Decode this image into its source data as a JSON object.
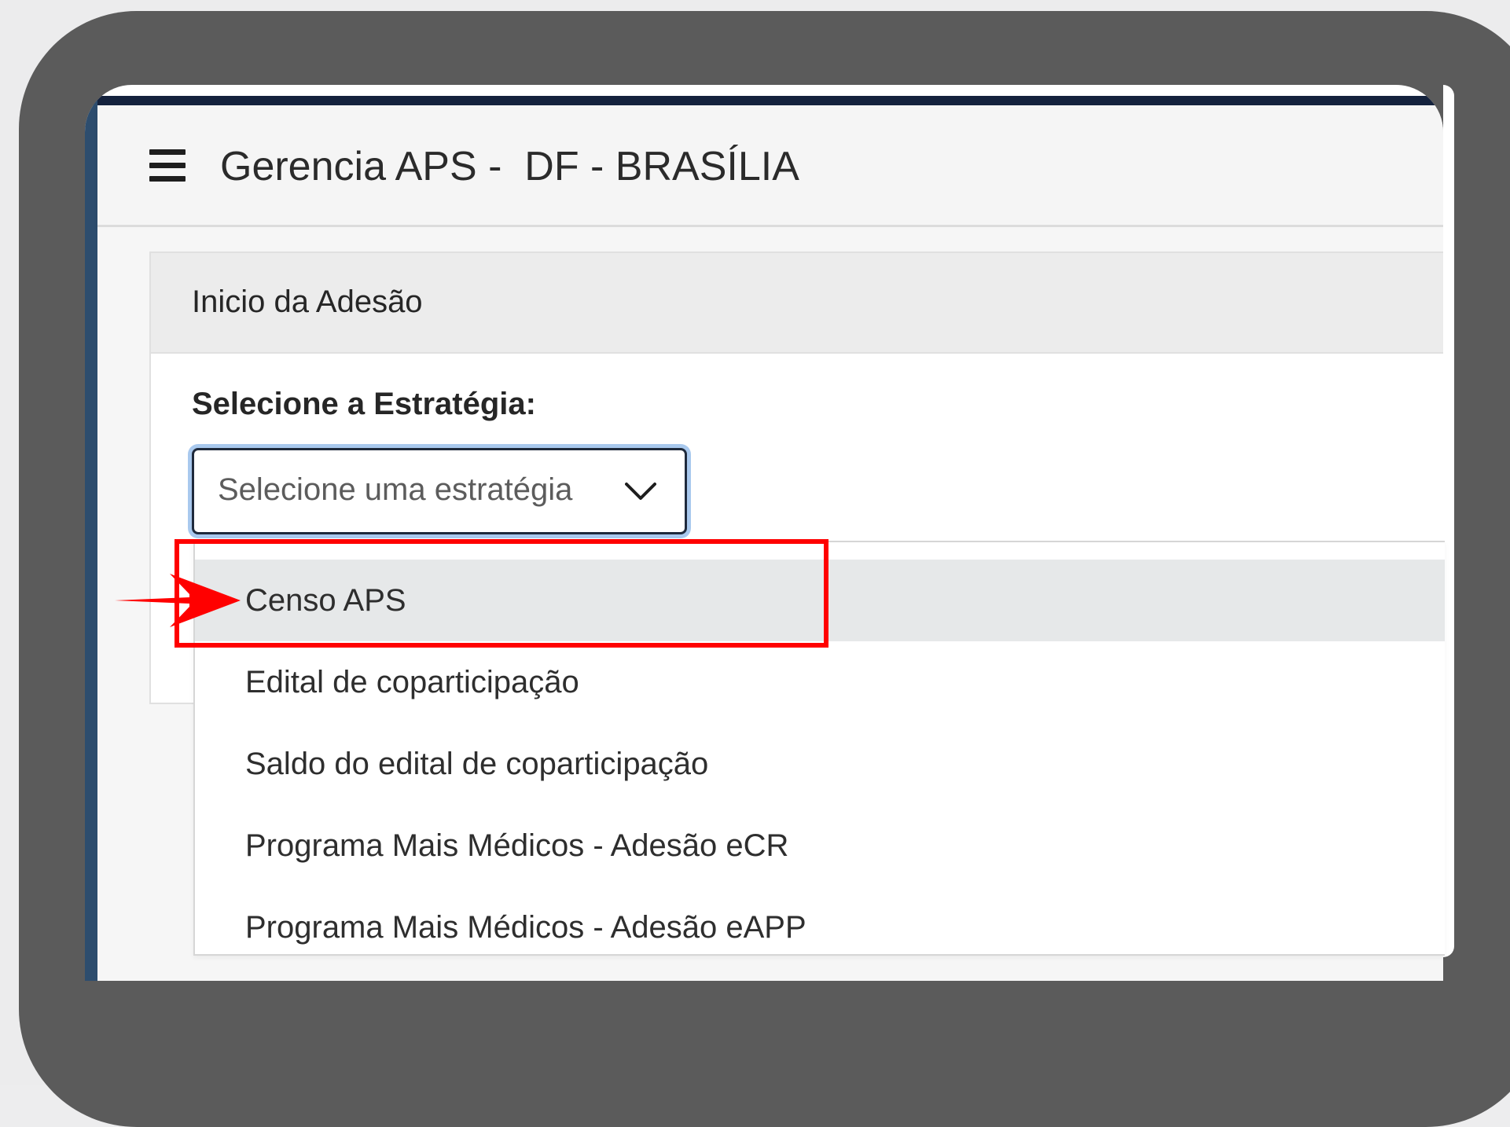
{
  "header": {
    "title": "Gerencia APS -  DF - BRASÍLIA",
    "menu_icon": "hamburger-menu-icon"
  },
  "card": {
    "title": "Inicio da Adesão",
    "field_label": "Selecione a Estratégia:"
  },
  "select": {
    "placeholder": "Selecione uma estratégia",
    "icon": "chevron-down-icon",
    "expanded": true,
    "options": [
      {
        "label": "Censo APS",
        "highlighted": true
      },
      {
        "label": "Edital de coparticipação",
        "highlighted": false
      },
      {
        "label": "Saldo do edital de coparticipação",
        "highlighted": false
      },
      {
        "label": "Programa Mais Médicos - Adesão eCR",
        "highlighted": false
      },
      {
        "label": "Programa Mais Médicos - Adesão eAPP",
        "highlighted": false
      }
    ]
  },
  "annotation": {
    "highlight_color": "#ff0000",
    "arrow_icon": "red-arrow-icon"
  },
  "colors": {
    "frame": "#5b5b5b",
    "navbar_top_rule": "#14223d",
    "sidebar_rule": "#2d4d6e",
    "focus_ring": "#a9c9ee"
  }
}
